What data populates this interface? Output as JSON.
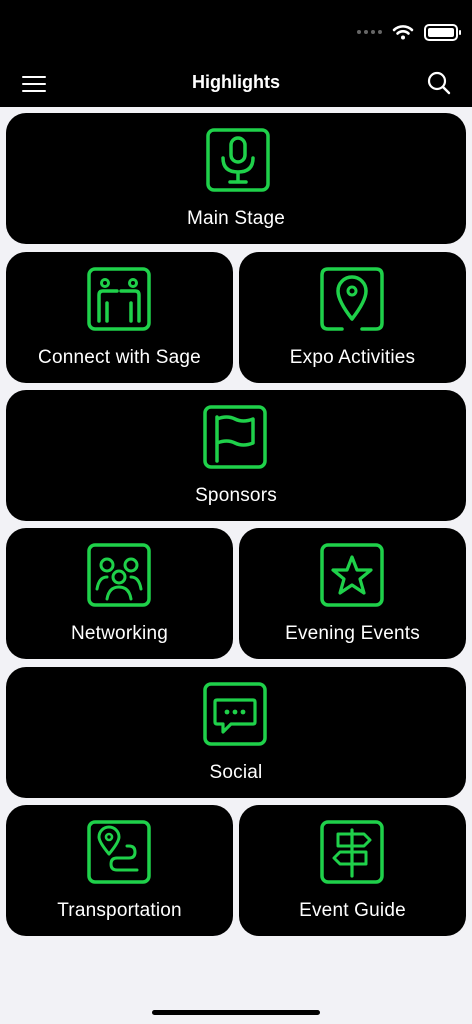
{
  "header": {
    "title": "Highlights"
  },
  "tiles": [
    {
      "label": "Main Stage"
    },
    {
      "label": "Connect with Sage"
    },
    {
      "label": "Expo Activities"
    },
    {
      "label": "Sponsors"
    },
    {
      "label": "Networking"
    },
    {
      "label": "Evening Events"
    },
    {
      "label": "Social"
    },
    {
      "label": "Transportation"
    },
    {
      "label": "Event Guide"
    }
  ],
  "colors": {
    "accent": "#1fd14a",
    "tile_bg": "#000000",
    "page_bg": "#f2f2f6"
  },
  "icons": [
    "microphone-icon",
    "people-connect-icon",
    "map-pin-icon",
    "flag-icon",
    "group-icon",
    "star-icon",
    "chat-icon",
    "route-icon",
    "signpost-icon"
  ]
}
